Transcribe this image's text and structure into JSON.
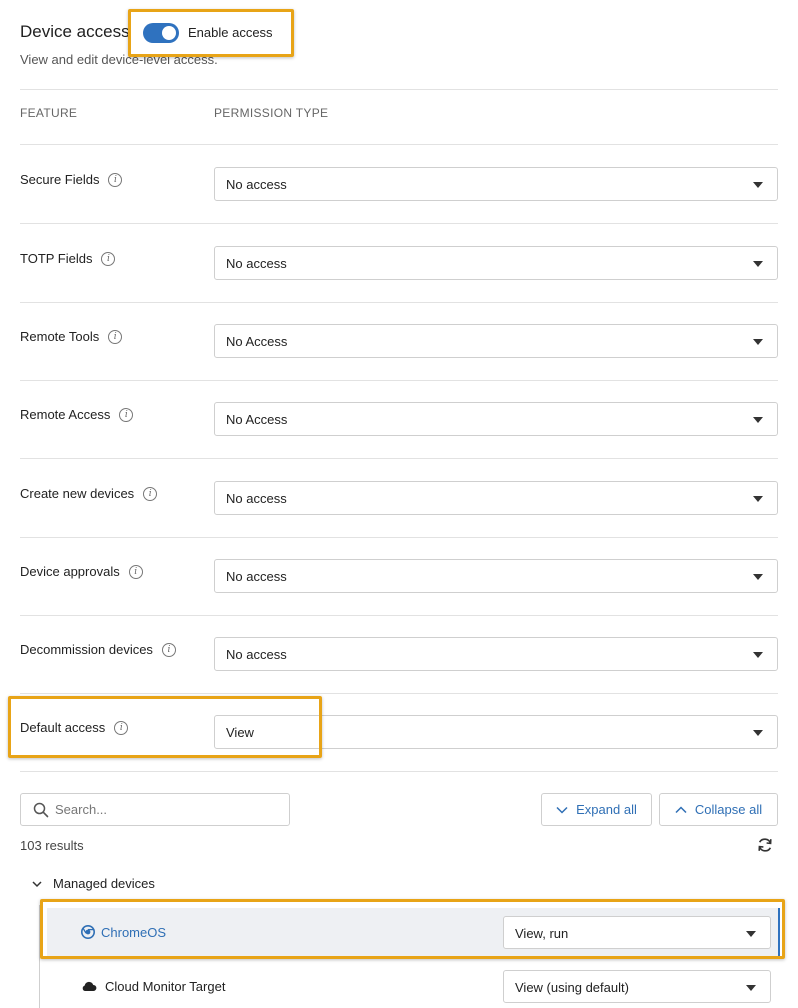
{
  "header": {
    "title": "Device access",
    "subtitle": "View and edit device-level access.",
    "toggle_label": "Enable access",
    "toggle_on": true
  },
  "columns": {
    "feature": "FEATURE",
    "permission": "PERMISSION TYPE"
  },
  "permissions": [
    {
      "label": "Secure Fields",
      "value": "No access"
    },
    {
      "label": "TOTP Fields",
      "value": "No access"
    },
    {
      "label": "Remote Tools",
      "value": "No Access"
    },
    {
      "label": "Remote Access",
      "value": "No Access"
    },
    {
      "label": "Create new devices",
      "value": "No access"
    },
    {
      "label": "Device approvals",
      "value": "No access"
    },
    {
      "label": "Decommission devices",
      "value": "No access"
    },
    {
      "label": "Default access",
      "value": "View"
    }
  ],
  "info_glyph": "i",
  "toolbar": {
    "search_placeholder": "Search...",
    "expand_label": "Expand all",
    "collapse_label": "Collapse all"
  },
  "results_text": "103 results",
  "tree": {
    "group_label": "Managed devices",
    "devices": [
      {
        "name": "ChromeOS",
        "value": "View, run",
        "icon": "chrome-icon",
        "selected": true
      },
      {
        "name": "Cloud Monitor Target",
        "value": "View (using default)",
        "icon": "cloud-icon",
        "selected": false
      }
    ]
  },
  "colors": {
    "accent": "#2f72bf",
    "highlight": "#e8a417",
    "link": "#2f6fb5"
  }
}
